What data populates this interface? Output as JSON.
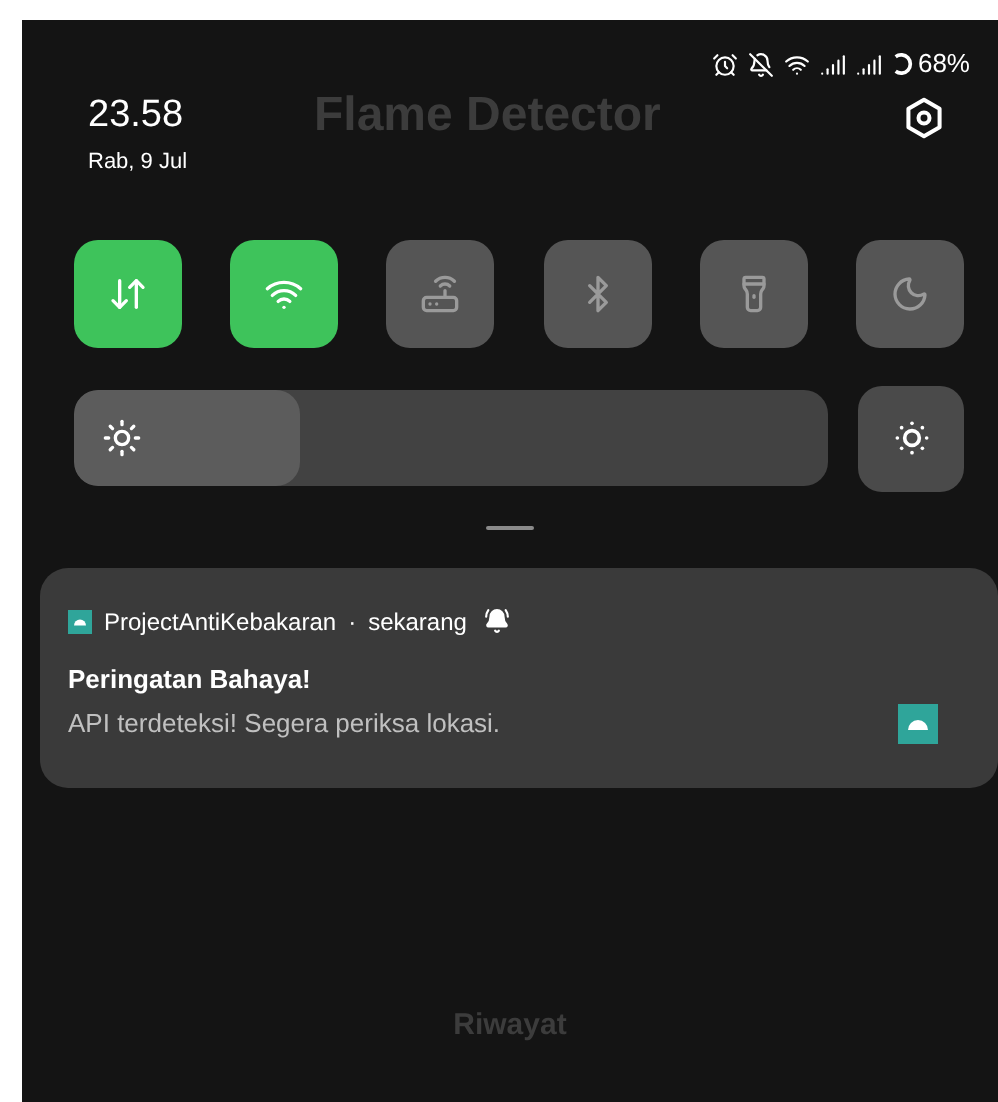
{
  "status_bar": {
    "battery": "68%"
  },
  "header": {
    "time": "23.58",
    "date": "Rab, 9 Jul"
  },
  "background_app": {
    "title": "Flame Detector",
    "footer": "Riwayat"
  },
  "quick_tiles": [
    {
      "kind": "data",
      "on": true
    },
    {
      "kind": "wifi",
      "on": true
    },
    {
      "kind": "hotspot",
      "on": false
    },
    {
      "kind": "bluetooth",
      "on": false
    },
    {
      "kind": "flashlight",
      "on": false
    },
    {
      "kind": "dnd",
      "on": false
    }
  ],
  "brightness": {
    "level": 0.3
  },
  "notification": {
    "app": "ProjectAntiKebakaran",
    "separator": "·",
    "time": "sekarang",
    "title": "Peringatan Bahaya!",
    "body": "API terdeteksi! Segera periksa lokasi."
  }
}
